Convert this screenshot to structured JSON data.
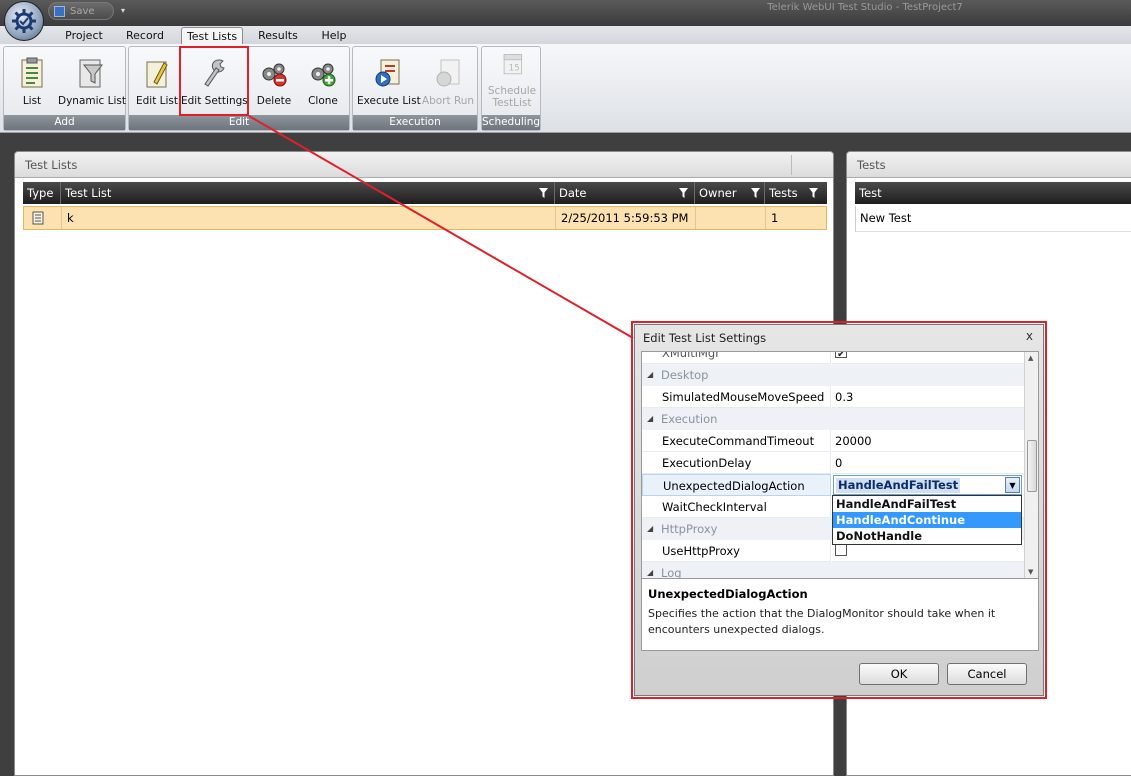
{
  "window": {
    "title": "Telerik WebUI Test Studio - TestProject7"
  },
  "qat": {
    "save_label": "Save",
    "dropdown": "▾"
  },
  "tabs": [
    {
      "label": "Project"
    },
    {
      "label": "Record"
    },
    {
      "label": "Test Lists"
    },
    {
      "label": "Results"
    },
    {
      "label": "Help"
    }
  ],
  "ribbon": {
    "groups": {
      "add": "Add",
      "edit": "Edit",
      "execution": "Execution",
      "scheduling": "Scheduling"
    },
    "buttons": {
      "list": "List",
      "dynamic_list": "Dynamic List",
      "edit_list": "Edit List",
      "edit_settings": "Edit Settings",
      "delete": "Delete",
      "clone": "Clone",
      "execute_list": "Execute List",
      "abort_run": "Abort Run",
      "schedule_line1": "Schedule",
      "schedule_line2": "TestList"
    }
  },
  "test_lists_panel": {
    "title": "Test Lists",
    "columns": {
      "type": "Type",
      "test_list": "Test List",
      "date": "Date",
      "owner": "Owner",
      "tests": "Tests"
    },
    "rows": [
      {
        "name": "k",
        "date": "2/25/2011 5:59:53 PM",
        "owner": "",
        "tests": "1"
      }
    ]
  },
  "tests_panel": {
    "title": "Tests",
    "columns": {
      "test": "Test"
    },
    "rows": [
      {
        "name": "New Test"
      }
    ]
  },
  "dialog": {
    "title": "Edit Test List Settings",
    "close": "x",
    "partial_top_prop": "XMultiMgr",
    "categories": {
      "desktop": "Desktop",
      "execution": "Execution",
      "httpproxy": "HttpProxy",
      "log": "Log"
    },
    "props": {
      "simulated_name": "SimulatedMouseMoveSpeed",
      "simulated_value": "0.3",
      "timeout_name": "ExecuteCommandTimeout",
      "timeout_value": "20000",
      "delay_name": "ExecutionDelay",
      "delay_value": "0",
      "unexpected_name": "UnexpectedDialogAction",
      "unexpected_value": "HandleAndFailTest",
      "wait_name": "WaitCheckInterval",
      "useproxy_name": "UseHttpProxy"
    },
    "dropdown_options": [
      "HandleAndFailTest",
      "HandleAndContinue",
      "DoNotHandle"
    ],
    "dropdown_selected_index": 1,
    "description": {
      "title": "UnexpectedDialogAction",
      "text": "Specifies the action that the DialogMonitor should take when it encounters unexpected dialogs."
    },
    "ok": "OK",
    "cancel": "Cancel"
  },
  "colors": {
    "highlight": "#e0202a",
    "row_selected": "#fbe2b0",
    "dropdown_selected": "#3399ff"
  }
}
